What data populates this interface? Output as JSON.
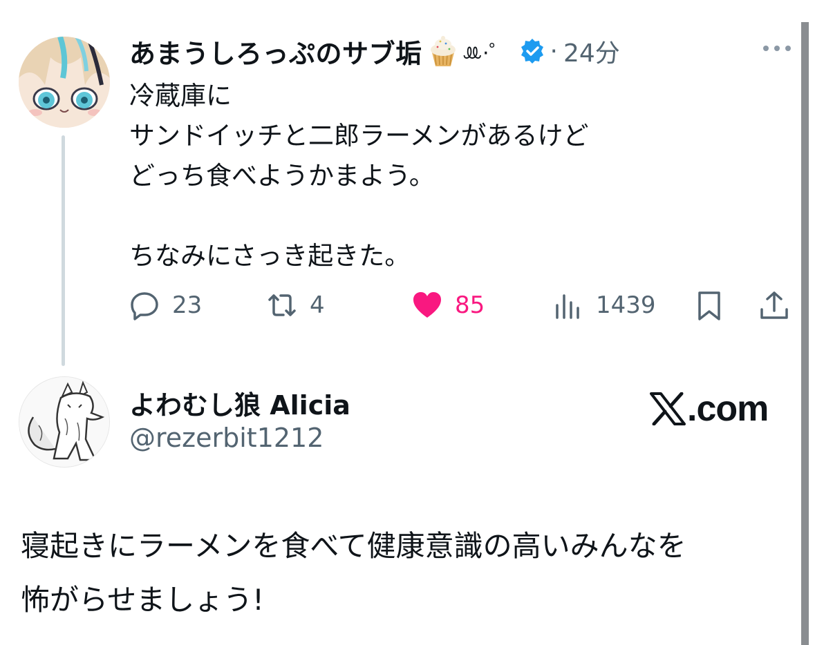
{
  "tweet": {
    "display_name": "あまうしろっぷのサブ垢",
    "name_emoji": "cupcake-icon",
    "name_kaomoji": "ꔛ·゜",
    "time_separator": "·",
    "time": "24分",
    "text": "冷蔵庫に\nサンドイッチと二郎ラーメンがあるけど\nどっち食べようかまよう。\n\nちなみにさっき起きた。",
    "reply_count": "23",
    "retweet_count": "4",
    "like_count": "85",
    "view_count": "1439"
  },
  "reply": {
    "display_name": "よわむし狼 Alicia",
    "handle": "@rezerbit1212",
    "site_label": ".com",
    "text": "寝起きにラーメンを食べて健康意識の高いみんなを\n怖がらせましょう!"
  },
  "colors": {
    "like": "#f91880",
    "verified": "#1d9bf0",
    "muted": "#536471",
    "thread_line": "#cfd9de"
  }
}
